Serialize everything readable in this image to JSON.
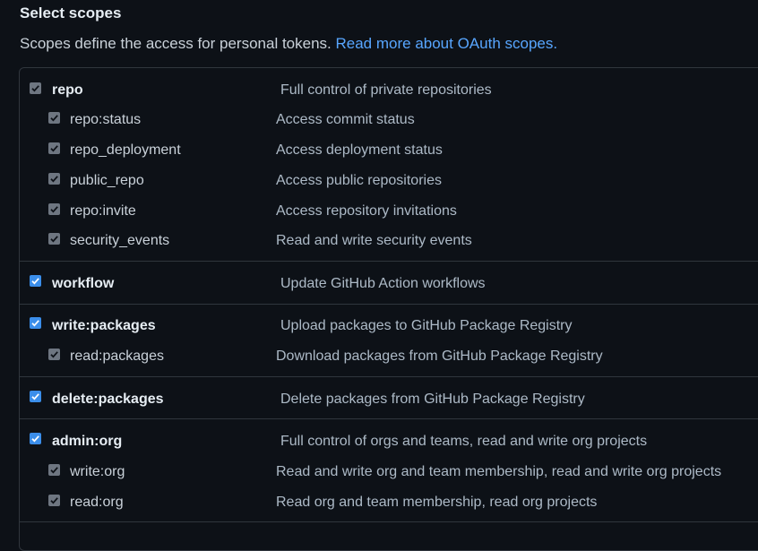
{
  "header": {
    "title": "Select scopes",
    "description": "Scopes define the access for personal tokens.",
    "link_text": "Read more about OAuth scopes."
  },
  "colors": {
    "background": "#0d1117",
    "border": "#30363d",
    "link": "#58a6ff",
    "checkbox_checked": "#3b8eea",
    "checkbox_disabled": "#6e7681"
  },
  "scopes": [
    {
      "name": "repo",
      "description": "Full control of private repositories",
      "checked": true
    },
    {
      "name": "repo:status",
      "description": "Access commit status",
      "checked": true
    },
    {
      "name": "repo_deployment",
      "description": "Access deployment status",
      "checked": true
    },
    {
      "name": "public_repo",
      "description": "Access public repositories",
      "checked": true
    },
    {
      "name": "repo:invite",
      "description": "Access repository invitations",
      "checked": true
    },
    {
      "name": "security_events",
      "description": "Read and write security events",
      "checked": true
    },
    {
      "name": "workflow",
      "description": "Update GitHub Action workflows",
      "checked": true
    },
    {
      "name": "write:packages",
      "description": "Upload packages to GitHub Package Registry",
      "checked": true
    },
    {
      "name": "read:packages",
      "description": "Download packages from GitHub Package Registry",
      "checked": true
    },
    {
      "name": "delete:packages",
      "description": "Delete packages from GitHub Package Registry",
      "checked": true
    },
    {
      "name": "admin:org",
      "description": "Full control of orgs and teams, read and write org projects",
      "checked": true
    },
    {
      "name": "write:org",
      "description": "Read and write org and team membership, read and write org projects",
      "checked": true
    },
    {
      "name": "read:org",
      "description": "Read org and team membership, read org projects",
      "checked": true
    }
  ]
}
